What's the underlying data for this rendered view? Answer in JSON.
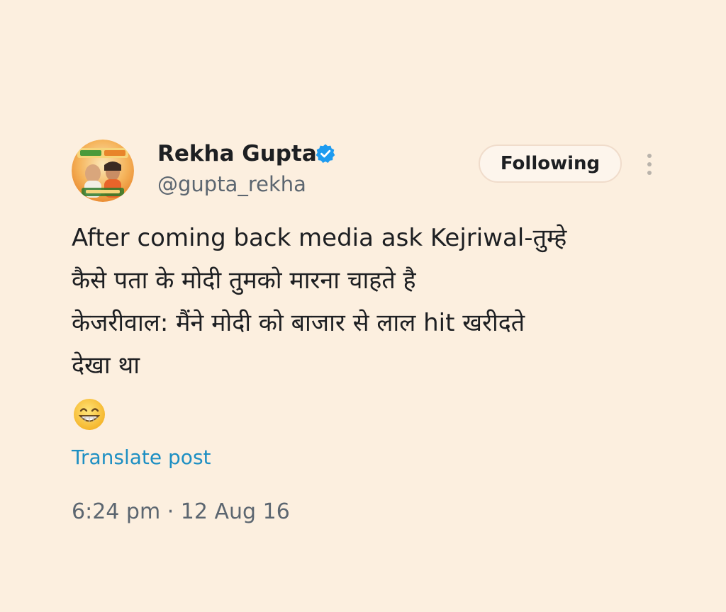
{
  "author": {
    "display_name": "Rekha Gupta",
    "handle": "@gupta_rekha",
    "verified": true,
    "avatar_icon": "profile-photo"
  },
  "header": {
    "follow_label": "Following",
    "more_icon": "more-vertical-icon"
  },
  "post": {
    "lines": [
      "After coming back media ask Kejriwal-तुम्हे",
      "कैसे पता के मोदी तुमको मारना चाहते है",
      "केजरीवाल: मैंने मोदी को बाजार से लाल hit खरीदते",
      "देखा था"
    ],
    "emoji": "😁"
  },
  "translate_label": "Translate post",
  "meta": {
    "time": "6:24 pm",
    "separator": " · ",
    "date": "12 Aug 16"
  },
  "colors": {
    "background": "#fcefdf",
    "link": "#1d8fc3",
    "verified_badge": "#1d9bf0",
    "secondary_text": "#5c6670"
  }
}
